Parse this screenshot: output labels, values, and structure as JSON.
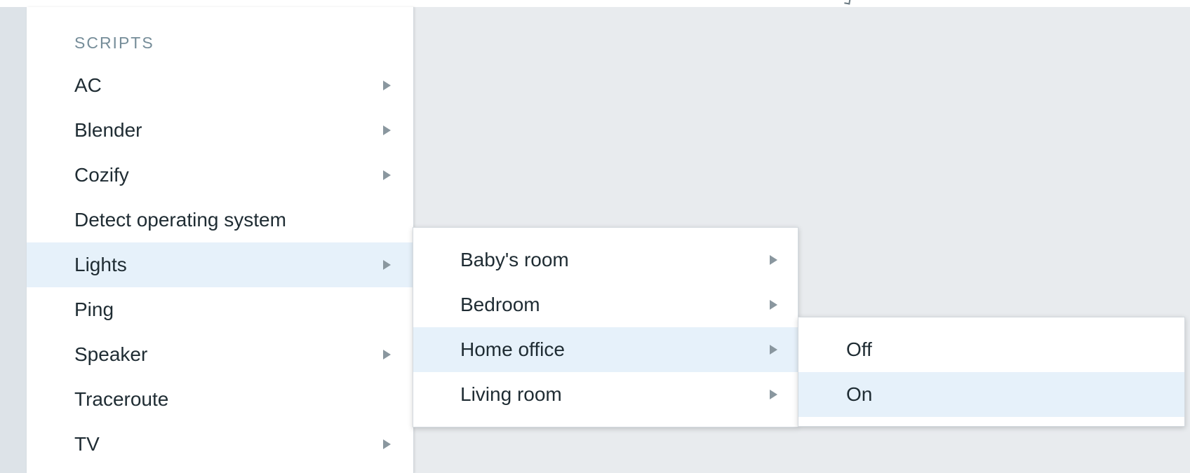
{
  "scripts_menu": {
    "header": "SCRIPTS",
    "items": [
      {
        "label": "AC",
        "has_submenu": true
      },
      {
        "label": "Blender",
        "has_submenu": true
      },
      {
        "label": "Cozify",
        "has_submenu": true
      },
      {
        "label": "Detect operating system",
        "has_submenu": false
      },
      {
        "label": "Lights",
        "has_submenu": true,
        "active": true
      },
      {
        "label": "Ping",
        "has_submenu": false
      },
      {
        "label": "Speaker",
        "has_submenu": true
      },
      {
        "label": "Traceroute",
        "has_submenu": false
      },
      {
        "label": "TV",
        "has_submenu": true
      }
    ]
  },
  "lights_submenu": {
    "items": [
      {
        "label": "Baby's room",
        "has_submenu": true
      },
      {
        "label": "Bedroom",
        "has_submenu": true
      },
      {
        "label": "Home office",
        "has_submenu": true,
        "active": true
      },
      {
        "label": "Living room",
        "has_submenu": true
      }
    ]
  },
  "home_office_submenu": {
    "items": [
      {
        "label": "Off",
        "has_submenu": false
      },
      {
        "label": "On",
        "has_submenu": false,
        "hovered": true
      }
    ]
  },
  "colors": {
    "background": "#e8ebee",
    "menu_background": "#ffffff",
    "active_item": "#e6f1fa",
    "header_text": "#768d99",
    "text": "#1f2c33",
    "arrow": "#8a979f"
  }
}
